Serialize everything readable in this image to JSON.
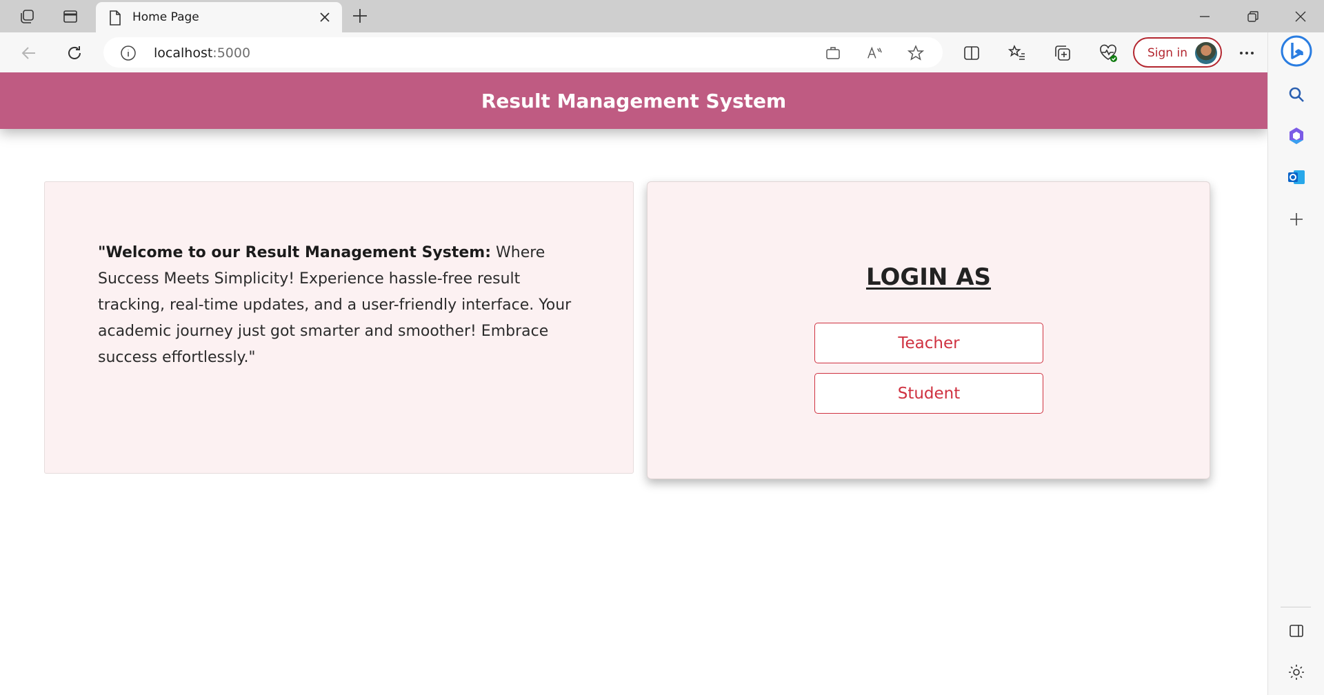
{
  "browser": {
    "tab": {
      "title": "Home Page"
    },
    "address": {
      "host": "localhost",
      "port": ":5000"
    },
    "signin_label": "Sign in"
  },
  "site": {
    "title": "Result Management System"
  },
  "welcome": {
    "lead": "\"Welcome to our Result Management System:",
    "body": " Where Success Meets Simplicity! Experience hassle-free result tracking, real-time updates, and a user-friendly interface. Your academic journey just got smarter and smoother! Embrace success effortlessly.\""
  },
  "login": {
    "heading": "LOGIN AS",
    "teacher_label": "Teacher",
    "student_label": "Student"
  },
  "colors": {
    "header": "#bf5b82",
    "card_bg": "#fcf1f2",
    "accent_red": "#cf3140"
  }
}
